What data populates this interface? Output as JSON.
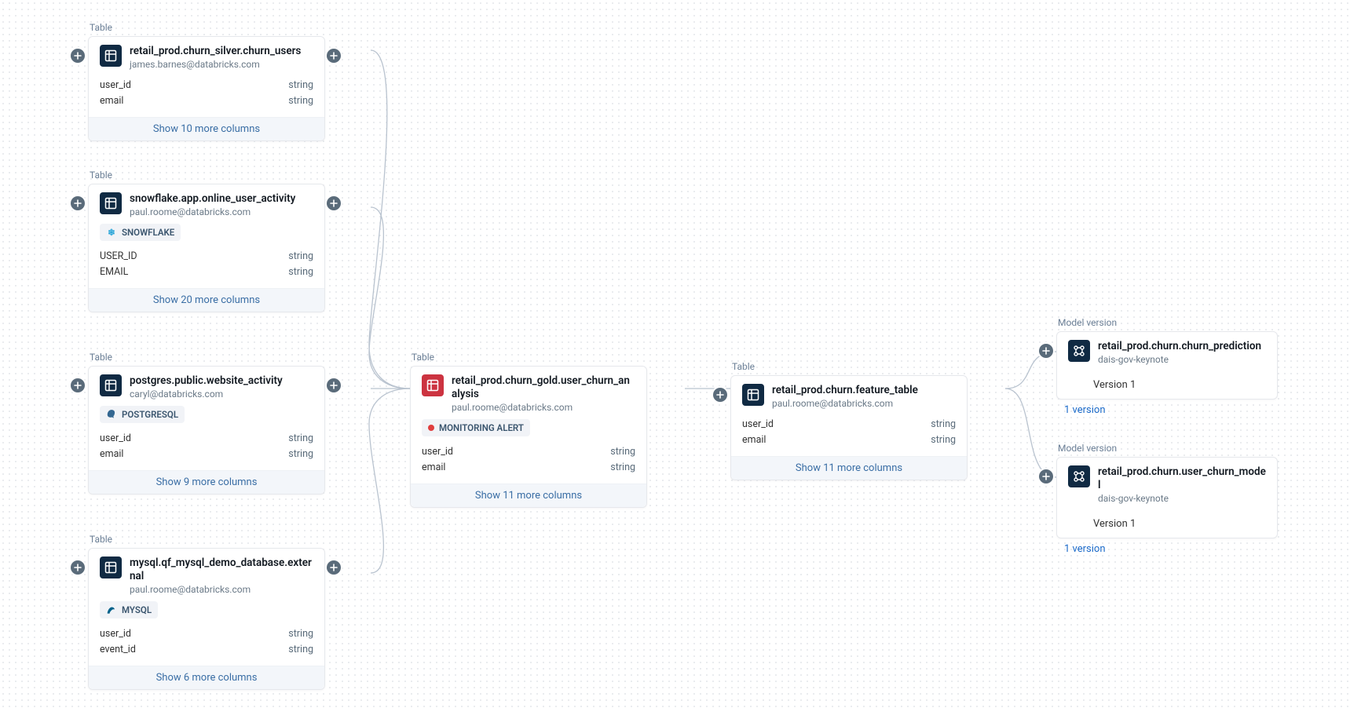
{
  "labels": {
    "table": "Table",
    "model_version": "Model version"
  },
  "strings": {
    "type_string": "string"
  },
  "nodes": {
    "n1": {
      "title": "retail_prod.churn_silver.churn_users",
      "subtitle": "james.barnes@databricks.com",
      "columns": [
        [
          "user_id",
          "string"
        ],
        [
          "email",
          "string"
        ]
      ],
      "more": "Show 10 more columns"
    },
    "n2": {
      "title": "snowflake.app.online_user_activity",
      "subtitle": "paul.roome@databricks.com",
      "badge": "SNOWFLAKE",
      "columns": [
        [
          "USER_ID",
          "string"
        ],
        [
          "EMAIL",
          "string"
        ]
      ],
      "more": "Show 20 more columns"
    },
    "n3": {
      "title": "postgres.public.website_activity",
      "subtitle": "caryl@databricks.com",
      "badge": "POSTGRESQL",
      "columns": [
        [
          "user_id",
          "string"
        ],
        [
          "email",
          "string"
        ]
      ],
      "more": "Show 9 more columns"
    },
    "n4": {
      "title": "mysql.qf_mysql_demo_database.external",
      "subtitle": "paul.roome@databricks.com",
      "badge": "MYSQL",
      "columns": [
        [
          "user_id",
          "string"
        ],
        [
          "event_id",
          "string"
        ]
      ],
      "more": "Show 6 more columns"
    },
    "n5": {
      "title": "retail_prod.churn_gold.user_churn_analysis",
      "subtitle": "paul.roome@databricks.com",
      "alert": "MONITORING ALERT",
      "columns": [
        [
          "user_id",
          "string"
        ],
        [
          "email",
          "string"
        ]
      ],
      "more": "Show 11 more columns"
    },
    "n6": {
      "title": "retail_prod.churn.feature_table",
      "subtitle": "paul.roome@databricks.com",
      "columns": [
        [
          "user_id",
          "string"
        ],
        [
          "email",
          "string"
        ]
      ],
      "more": "Show 11 more columns"
    },
    "m1": {
      "title": "retail_prod.churn.churn_prediction",
      "subtitle": "dais-gov-keynote",
      "version": "Version 1",
      "versions_link": "1 version"
    },
    "m2": {
      "title": "retail_prod.churn.user_churn_model",
      "subtitle": "dais-gov-keynote",
      "version": "Version 1",
      "versions_link": "1 version"
    }
  }
}
